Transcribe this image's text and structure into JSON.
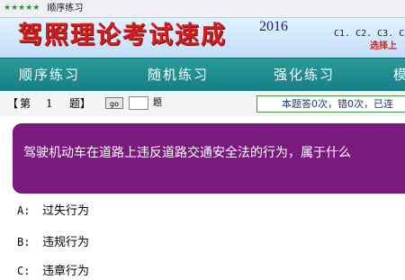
{
  "titlebar": {
    "stars": "★★★★★",
    "title": "顺序练习"
  },
  "banner": {
    "title": "驾照理论考试速成",
    "year": "2016",
    "classes": "C1. C2. C3. C4",
    "choose": "选择上"
  },
  "nav": {
    "items": [
      "顺序练习",
      "随机练习",
      "强化练习",
      "模"
    ]
  },
  "question_header": {
    "bracket_open": "【",
    "prefix": "第",
    "number": "1",
    "suffix_label": "题】",
    "go_label": "go",
    "input_value": "",
    "after_input": "题",
    "stats": "本题答0次，错0次，已连"
  },
  "question": {
    "text": "驾驶机动车在道路上违反道路交通安全法的行为，属于什么"
  },
  "options": [
    {
      "letter": "A:",
      "text": "过失行为"
    },
    {
      "letter": "B:",
      "text": "违规行为"
    },
    {
      "letter": "C:",
      "text": "违章行为"
    }
  ],
  "colors": {
    "nav_bg": "#1e8c8f",
    "question_bg": "#7b1a7e",
    "banner_title": "#d71b1b",
    "stats_border": "#3e9a3e"
  }
}
